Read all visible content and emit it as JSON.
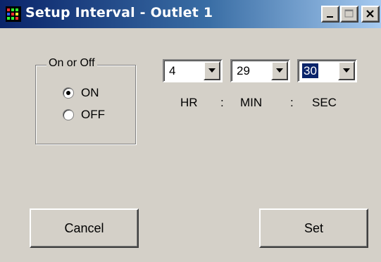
{
  "window": {
    "title": "Setup Interval - Outlet 1"
  },
  "titlebar_buttons": {
    "minimize": "minimize-icon",
    "maximize": "maximize-icon",
    "close": "close-icon"
  },
  "power_group": {
    "legend": "On or Off",
    "options": [
      {
        "label": "ON",
        "checked": true
      },
      {
        "label": "OFF",
        "checked": false
      }
    ]
  },
  "interval": {
    "hours": "4",
    "minutes": "29",
    "seconds": "30",
    "focused_field": "seconds"
  },
  "labels": {
    "hr": "HR",
    "sep1": ":",
    "min": "MIN",
    "sep2": ":",
    "sec": "SEC"
  },
  "buttons": {
    "cancel": "Cancel",
    "set": "Set"
  },
  "colors": {
    "dialog_face": "#d4d0c8",
    "title_active": "#0a246a",
    "selection": "#0a246a"
  }
}
